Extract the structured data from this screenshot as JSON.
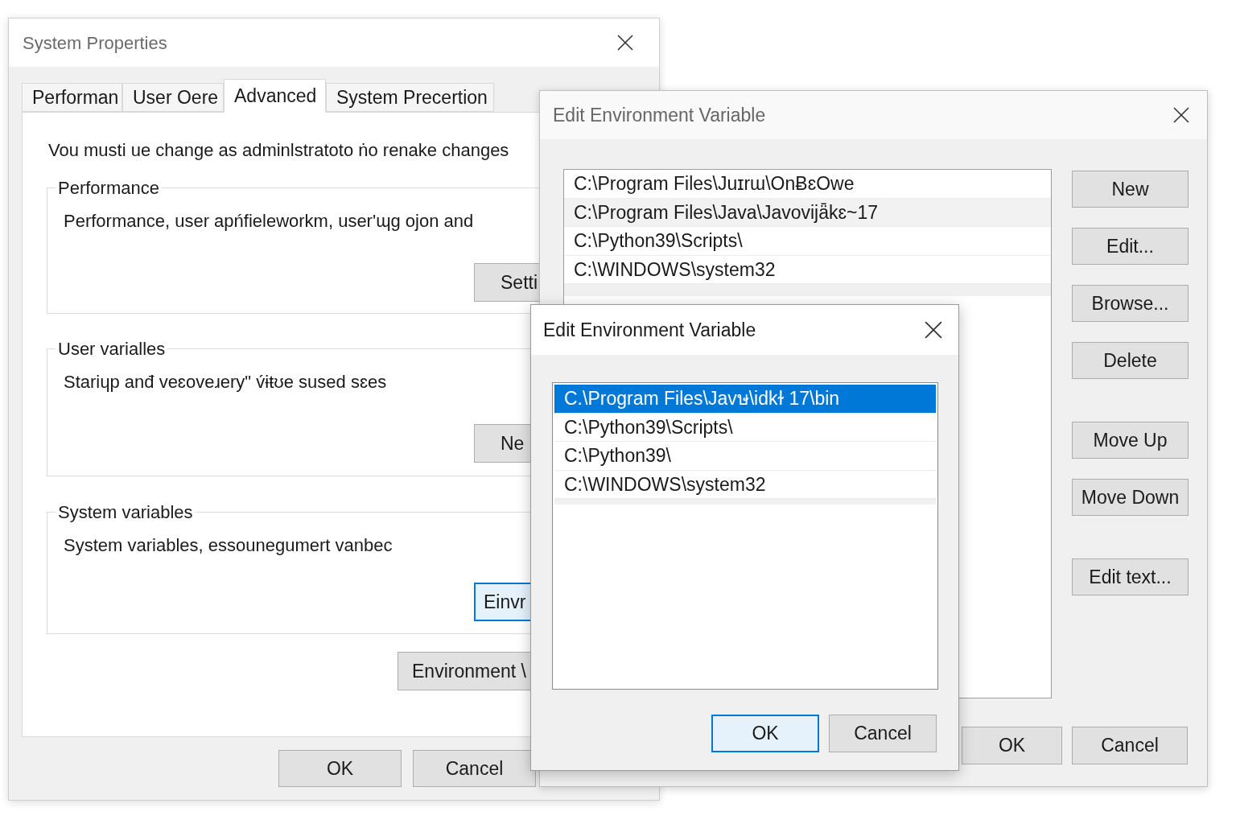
{
  "system_properties": {
    "title": "System Properties",
    "tabs": [
      {
        "label": "Performan",
        "selected": false
      },
      {
        "label": "User Oere",
        "selected": false
      },
      {
        "label": "Advanced",
        "selected": true
      },
      {
        "label": "System Precertion",
        "selected": false
      }
    ],
    "admin_note": "Vou musti ue change as adminlstratoto ṅo renake changes",
    "groups": [
      {
        "title": "Performance",
        "description": "Performance, user apńfieleworkm, user'ɰg ojon and",
        "button": {
          "label": "Setti",
          "focused": false
        }
      },
      {
        "title": "User varialles",
        "description": "Stariɥp anđ veɛoveɹery\" v́ɨŧʊe sused sɛes",
        "button": {
          "label": "Ne",
          "focused": false
        }
      },
      {
        "title": "System variables",
        "description": "System variables, essounegumert vanbec",
        "button": {
          "label": "Einvr",
          "focused": true
        }
      }
    ],
    "environment_button": "Environment \\",
    "buttons": [
      {
        "label": "OK",
        "focused": false
      },
      {
        "label": "Cancel",
        "focused": false
      }
    ]
  },
  "edit_dialog_back": {
    "title": "Edit Environment Variable",
    "entries": [
      {
        "text": "C:\\Program Files\\Juɪrɯ\\OnɃɛOwe",
        "selected": false
      },
      {
        "text": "C:\\Program Files\\Java\\Javovijǟkɛ~17",
        "selected": true
      },
      {
        "text": "C:\\Python39\\Scripts\\",
        "selected": false
      },
      {
        "text": "C:\\WINDOWS\\system32",
        "selected": false
      }
    ],
    "side_button_groups": [
      [
        "New",
        "Edit...",
        "Browse...",
        "Delete"
      ],
      [
        "Move Up",
        "Move Down"
      ],
      [
        "Edit text..."
      ]
    ],
    "buttons": [
      {
        "label": "OK",
        "focused": false
      },
      {
        "label": "Cancel",
        "focused": false
      }
    ]
  },
  "edit_dialog_front": {
    "title": "Edit Environment Variable",
    "entries": [
      {
        "text": "C.\\Program Files\\Javษ\\idkɫ 17\\bin",
        "selected": true
      },
      {
        "text": "C:\\Python39\\Scripts\\",
        "selected": false
      },
      {
        "text": "C:\\Python39\\",
        "selected": false
      },
      {
        "text": "C:\\WINDOWS\\system32",
        "selected": false
      }
    ],
    "buttons": [
      {
        "label": "OK",
        "focused": true
      },
      {
        "label": "Cancel",
        "focused": false
      }
    ]
  }
}
